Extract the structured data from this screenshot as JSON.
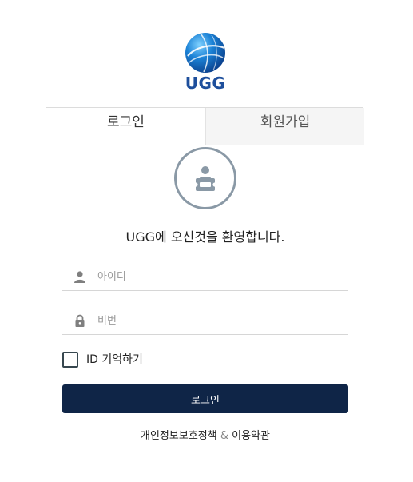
{
  "logo": {
    "text": "UGG",
    "brand_color": "#1e4f9c"
  },
  "tabs": {
    "login": "로그인",
    "signup": "회원가입"
  },
  "welcome_message": "UGG에 오신것을 환영합니다.",
  "form": {
    "id_placeholder": "아이디",
    "password_placeholder": "비번",
    "remember_label": "ID 기억하기",
    "remember_checked": false,
    "login_button": "로그인"
  },
  "footer": {
    "privacy_link": "개인정보보호정책",
    "separator": "&",
    "terms_link": "이용약관"
  },
  "colors": {
    "button_bg": "#0f2547",
    "avatar_ring": "#8a99a6"
  },
  "icons": {
    "avatar": "user-id-card-icon",
    "id_field": "user-icon",
    "password_field": "lock-icon"
  }
}
